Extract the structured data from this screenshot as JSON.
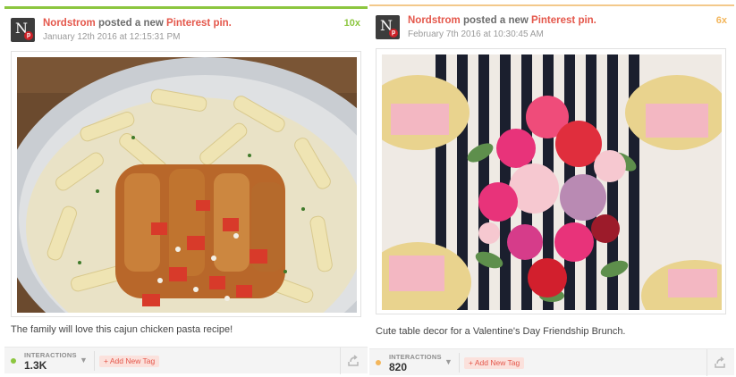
{
  "posts": [
    {
      "author": "Nordstrom",
      "action": " posted a new ",
      "network": "Pinterest pin.",
      "timestamp": "January 12th 2016 at 12:15:31 PM",
      "count": "10x",
      "caption": "The family will love this cajun chicken pasta recipe!",
      "interactions_label": "INTERACTIONS",
      "interactions_value": "1.3K",
      "tag_button": "+ Add New Tag",
      "avatar_letter": "N",
      "accent_color": "#8cc63f"
    },
    {
      "author": "Nordstrom",
      "action": " posted a new ",
      "network": "Pinterest pin.",
      "timestamp": "February 7th 2016 at 10:30:45 AM",
      "count": "6x",
      "caption": "Cute table decor for a Valentine's Day Friendship Brunch.",
      "interactions_label": "INTERACTIONS",
      "interactions_value": "820",
      "tag_button": "+ Add New Tag",
      "avatar_letter": "N",
      "accent_color": "#f3b65b"
    }
  ],
  "icons": {
    "avatar": "nordstrom-logo-icon",
    "pinterest": "pinterest-badge-icon",
    "dropdown": "chevron-down-icon",
    "share": "share-icon"
  }
}
